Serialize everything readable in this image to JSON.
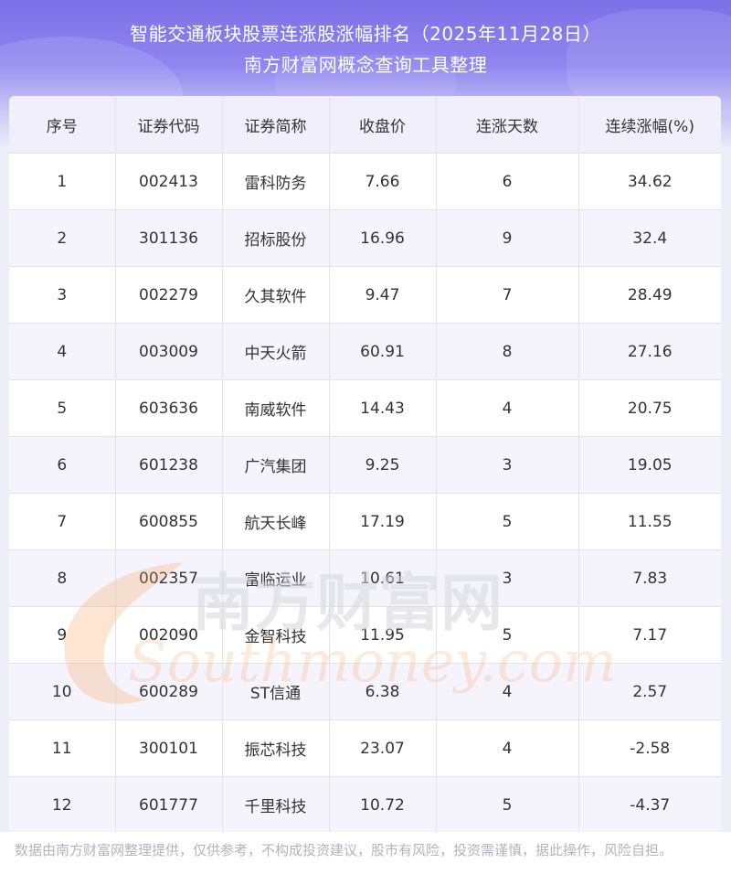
{
  "header": {
    "title_line1": "智能交通板块股票连涨股涨幅排名（2025年11月28日）",
    "title_line2": "南方财富网概念查询工具整理"
  },
  "table": {
    "columns": [
      "序号",
      "证券代码",
      "证券简称",
      "收盘价",
      "连涨天数",
      "连续涨幅(%)"
    ],
    "rows": [
      [
        "1",
        "002413",
        "雷科防务",
        "7.66",
        "6",
        "34.62"
      ],
      [
        "2",
        "301136",
        "招标股份",
        "16.96",
        "9",
        "32.4"
      ],
      [
        "3",
        "002279",
        "久其软件",
        "9.47",
        "7",
        "28.49"
      ],
      [
        "4",
        "003009",
        "中天火箭",
        "60.91",
        "8",
        "27.16"
      ],
      [
        "5",
        "603636",
        "南威软件",
        "14.43",
        "4",
        "20.75"
      ],
      [
        "6",
        "601238",
        "广汽集团",
        "9.25",
        "3",
        "19.05"
      ],
      [
        "7",
        "600855",
        "航天长峰",
        "17.19",
        "5",
        "11.55"
      ],
      [
        "8",
        "002357",
        "富临运业",
        "10.61",
        "3",
        "7.83"
      ],
      [
        "9",
        "002090",
        "金智科技",
        "11.95",
        "5",
        "7.17"
      ],
      [
        "10",
        "600289",
        "ST信通",
        "6.38",
        "4",
        "2.57"
      ],
      [
        "11",
        "300101",
        "振芯科技",
        "23.07",
        "4",
        "-2.58"
      ],
      [
        "12",
        "601777",
        "千里科技",
        "10.72",
        "5",
        "-4.37"
      ]
    ]
  },
  "watermark": {
    "cn": "南方财富网",
    "en": "Southmoney.com"
  },
  "footer": {
    "disclaimer": "数据由南方财富网整理提供，仅供参考，不构成投资建议，股市有风险，投资需谨慎，据此操作，风险自担。"
  },
  "colors": {
    "header_gradient_top": "#7d6fe6",
    "header_row_bg": "#f0effb",
    "alt_row_bg": "#f5f4fd",
    "watermark_orange": "#f5a15c"
  }
}
